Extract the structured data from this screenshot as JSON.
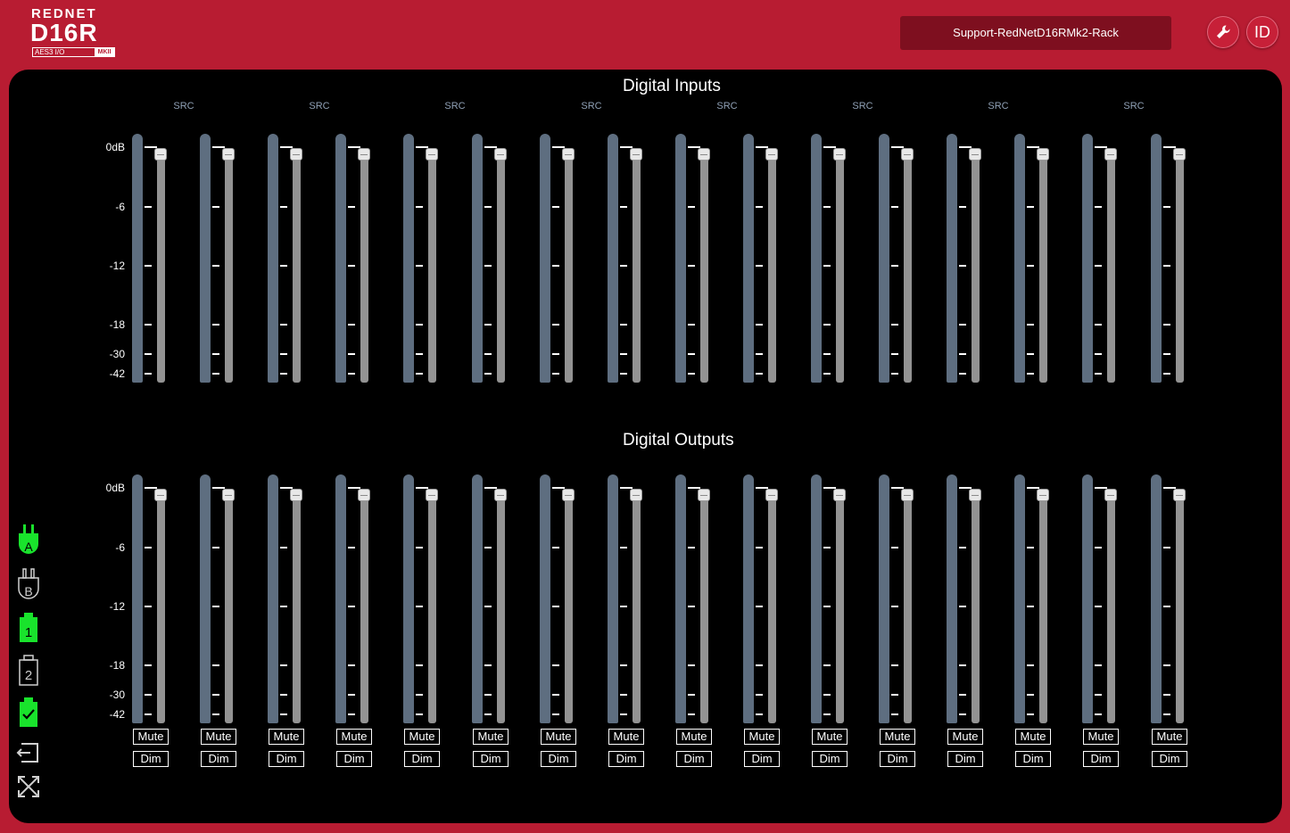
{
  "brand": {
    "line1": "REDNET",
    "model": "D16R",
    "sub_left": "AES3 I/O",
    "sub_right": "MKII"
  },
  "header": {
    "device_name": "Support-RedNetD16RMk2-Rack",
    "tool_icon": "wrench-icon",
    "id_label": "ID"
  },
  "inputs": {
    "title": "Digital Inputs",
    "src_label": "SRC",
    "src_count": 8,
    "channel_count": 16,
    "scale": [
      "0dB",
      "-6",
      "-12",
      "-18",
      "-30",
      "-42"
    ]
  },
  "outputs": {
    "title": "Digital Outputs",
    "channel_count": 16,
    "scale": [
      "0dB",
      "-6",
      "-12",
      "-18",
      "-30",
      "-42"
    ],
    "mute_label": "Mute",
    "dim_label": "Dim"
  },
  "sidebar": [
    {
      "icon": "network-a-plug-icon",
      "label": "A",
      "active": true
    },
    {
      "icon": "network-b-plug-icon",
      "label": "B",
      "active": false
    },
    {
      "icon": "psu-1-icon",
      "label": "1",
      "active": true
    },
    {
      "icon": "psu-2-icon",
      "label": "2",
      "active": false
    },
    {
      "icon": "status-ok-icon",
      "active": true
    },
    {
      "icon": "exit-icon",
      "active": false
    },
    {
      "icon": "expand-icon",
      "active": false
    }
  ],
  "colors": {
    "accent": "#b81c32",
    "panel": "#000000",
    "meter": "#5e6e80",
    "fader_track": "#939393",
    "active_icon": "#19e32c"
  }
}
